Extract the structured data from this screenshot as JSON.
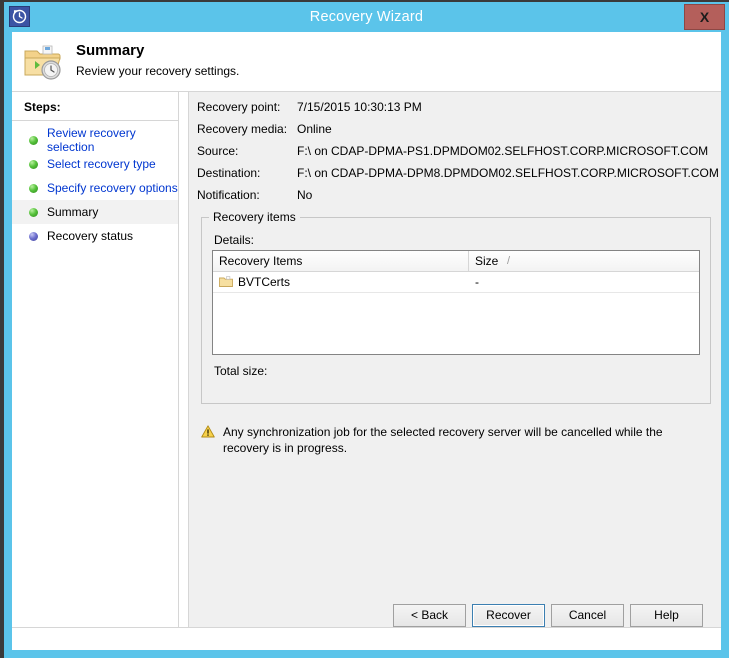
{
  "window": {
    "title": "Recovery Wizard",
    "icon": "clock-restore-icon",
    "close_label": "X",
    "accent_color": "#5bc4ea",
    "close_color": "#b45f5b"
  },
  "header": {
    "icon": "folder-recovery-icon",
    "title": "Summary",
    "subtitle": "Review your recovery settings."
  },
  "sidebar": {
    "heading": "Steps:",
    "items": [
      {
        "label": "Review recovery selection",
        "bullet": "green",
        "state": "done"
      },
      {
        "label": "Select recovery type",
        "bullet": "green",
        "state": "done"
      },
      {
        "label": "Specify recovery options",
        "bullet": "green",
        "state": "done"
      },
      {
        "label": "Summary",
        "bullet": "green",
        "state": "current"
      },
      {
        "label": "Recovery status",
        "bullet": "blue",
        "state": "pending"
      }
    ]
  },
  "summary": {
    "fields": [
      {
        "label": "Recovery point:",
        "value": "7/15/2015 10:30:13 PM"
      },
      {
        "label": "Recovery media:",
        "value": "Online"
      },
      {
        "label": "Source:",
        "value": "F:\\ on CDAP-DPMA-PS1.DPMDOM02.SELFHOST.CORP.MICROSOFT.COM"
      },
      {
        "label": "Destination:",
        "value": "F:\\ on CDAP-DPMA-DPM8.DPMDOM02.SELFHOST.CORP.MICROSOFT.COM"
      },
      {
        "label": "Notification:",
        "value": "No"
      }
    ]
  },
  "recovery_items": {
    "group_title": "Recovery items",
    "details_label": "Details:",
    "total_size_label": "Total size:",
    "columns": [
      {
        "label": "Recovery Items",
        "sort_indicator": ""
      },
      {
        "label": "Size",
        "sort_indicator": "/"
      }
    ],
    "rows": [
      {
        "name": "BVTCerts",
        "size": "-",
        "icon": "folder-icon"
      }
    ]
  },
  "warning": {
    "icon": "warning-triangle-icon",
    "text": "Any synchronization job for the selected recovery server will be cancelled while the recovery is in progress."
  },
  "buttons": [
    {
      "label": "< Back",
      "default": false
    },
    {
      "label": "Recover",
      "default": true
    },
    {
      "label": "Cancel",
      "default": false
    },
    {
      "label": "Help",
      "default": false
    }
  ]
}
